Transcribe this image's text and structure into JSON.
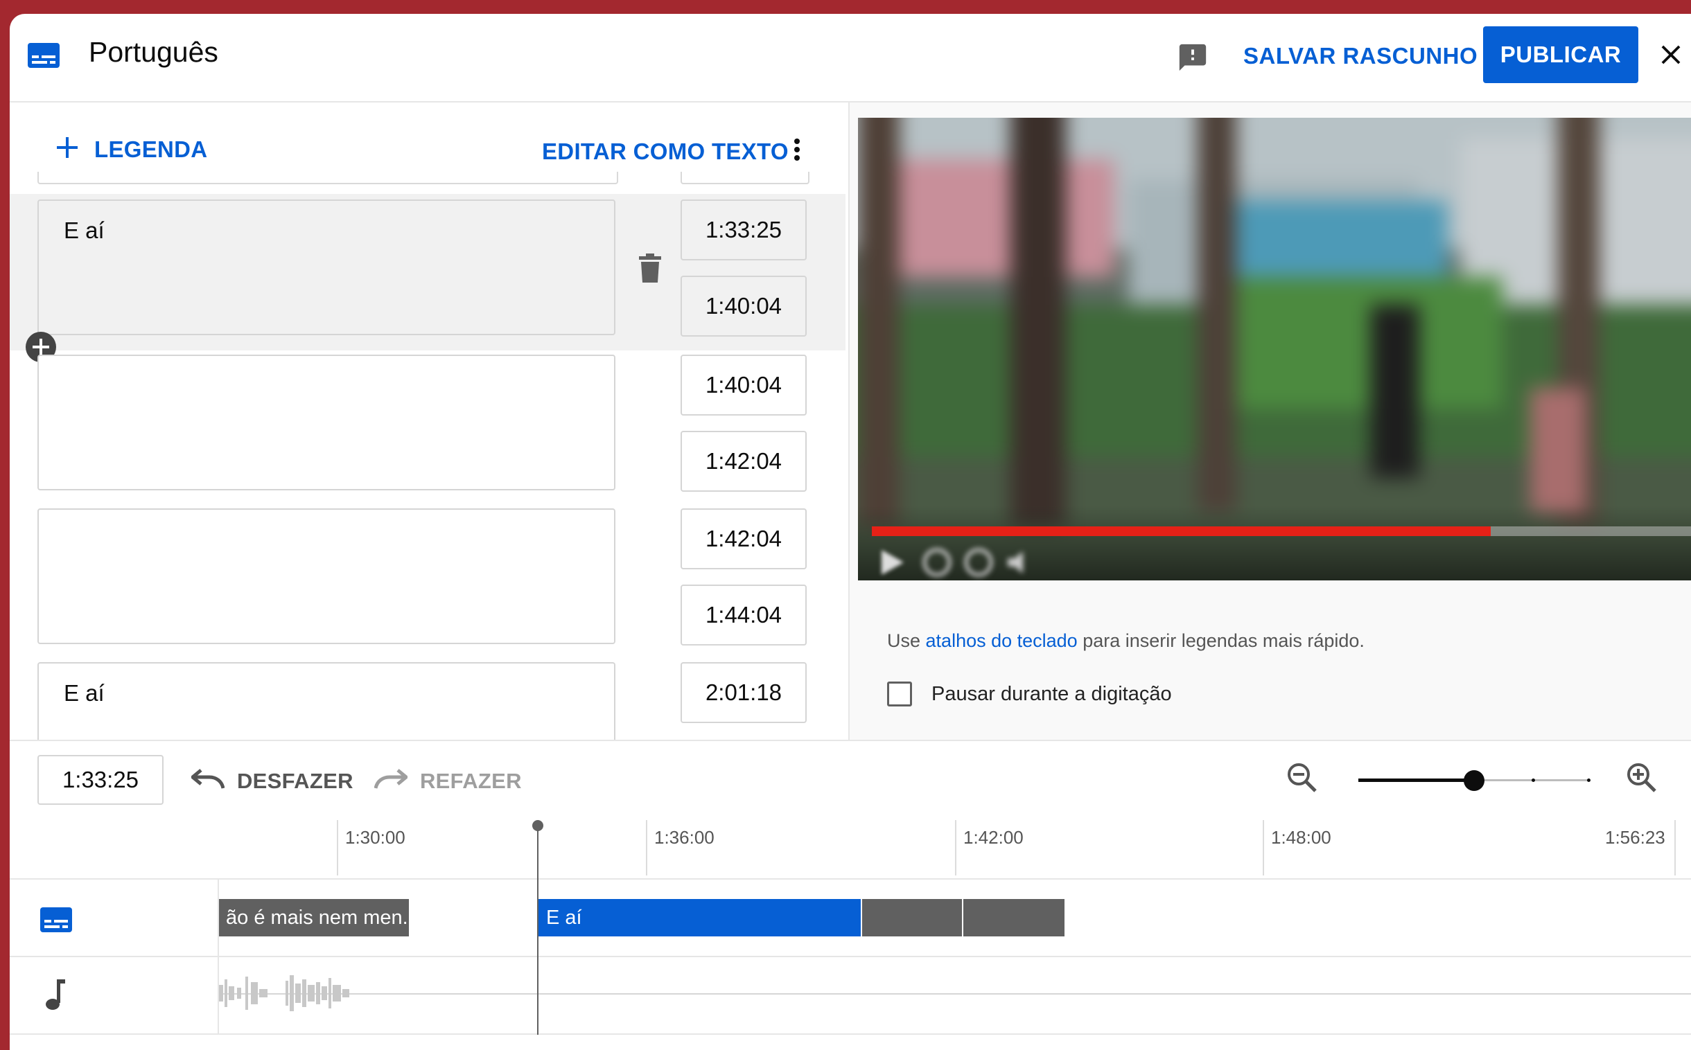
{
  "header": {
    "title": "Português",
    "save_draft": "SALVAR RASCUNHO",
    "publish": "PUBLICAR"
  },
  "editor": {
    "add_caption": "LEGENDA",
    "edit_as_text": "EDITAR COMO TEXTO",
    "captions": [
      {
        "text": "E aí",
        "start": "1:33:25",
        "end": "1:40:04"
      },
      {
        "text": "",
        "start": "1:40:04",
        "end": "1:42:04"
      },
      {
        "text": "",
        "start": "1:42:04",
        "end": "1:44:04"
      },
      {
        "text": "E aí",
        "start": "2:01:18",
        "end": ""
      }
    ]
  },
  "preview": {
    "hint_prefix": "Use ",
    "hint_link": "atalhos do teclado",
    "hint_suffix": " para inserir legendas mais rápido.",
    "pause_label": "Pausar durante a digitação",
    "pause_checked": false,
    "video_progress": 0.75
  },
  "timeline": {
    "current_time": "1:33:25",
    "undo": "DESFAZER",
    "redo": "REFAZER",
    "zoom_level": 0.5,
    "ticks": [
      "1:30:00",
      "1:36:00",
      "1:42:00",
      "1:48:00",
      "1:56:23"
    ],
    "segments": [
      {
        "text": "ão é mais nem men...",
        "style": "grey"
      },
      {
        "text": "E aí",
        "style": "blue"
      },
      {
        "text": "",
        "style": "grey"
      },
      {
        "text": "",
        "style": "grey"
      }
    ]
  },
  "colors": {
    "accent": "#065fd4",
    "background_frame": "#a3282f",
    "progress": "#e62117"
  }
}
